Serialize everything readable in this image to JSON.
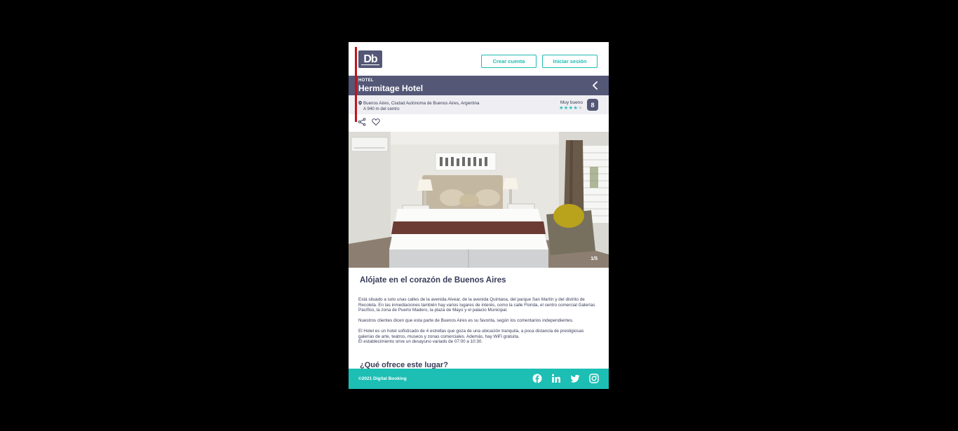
{
  "header": {
    "logo_text": "Db",
    "create_account_label": "Crear cuenta",
    "login_label": "Iniciar sesión"
  },
  "hotel": {
    "category": "HOTEL",
    "name": "Hermitage Hotel",
    "address": "Buenos Aires, Ciudad Autónoma de Buenos Aires, Argentina",
    "distance": "A 940 m del centro",
    "rating_label": "Muy bueno",
    "stars": 4,
    "score": "8"
  },
  "gallery": {
    "counter": "1/5"
  },
  "description": {
    "title": "Alójate en el corazón de Buenos Aires",
    "paragraphs": [
      "Está situado a solo unas calles de la avenida Alvear, de la avenida Quintana, del parque San Martín y del distrito de Recoleta. En las inmediaciones también hay varios lugares de interés, como la calle Florida, el centro comercial Galerías Pacífico, la zona de Puerto Madero, la plaza de Mayo y el palacio Municipal.",
      "Nuestros clientes dicen que esta parte de Buenos Aires es su favorita, según los comentarios independientes.",
      "El Hotel es un hotel sofisticado de 4 estrellas que goza de una ubicación tranquila, a poca distancia de prestigiosas galerías de arte, teatros, museos y zonas comerciales. Además, hay WiFi gratuita.",
      "El establecimiento sirve un desayuno variado de 07:00 a 10:30."
    ]
  },
  "offers": {
    "title": "¿Qué ofrece este lugar?"
  },
  "footer": {
    "copyright": "©2021 Digital Booking",
    "social": [
      "facebook-icon",
      "linkedin-icon",
      "twitter-icon",
      "instagram-icon"
    ]
  },
  "colors": {
    "primary": "#545776",
    "accent": "#1dbeb4",
    "text": "#383b58"
  }
}
